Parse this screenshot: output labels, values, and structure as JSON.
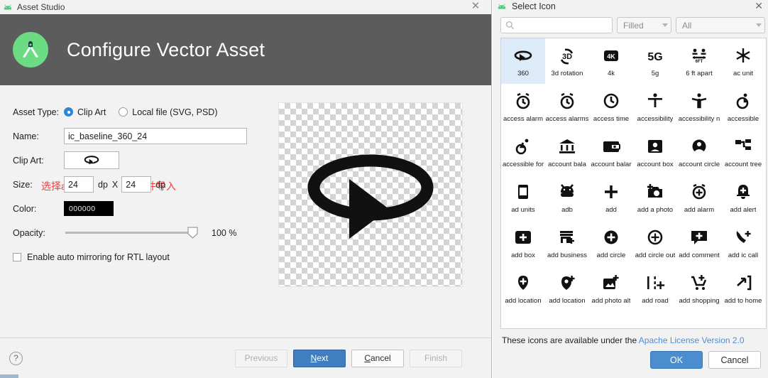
{
  "left_dialog": {
    "titlebar": {
      "title": "Asset Studio",
      "close_icon": "close-icon",
      "logo_icon": "android-logo-icon"
    },
    "header": {
      "title": "Configure Vector Asset",
      "icon": "android-studio-icon"
    },
    "annotations": [
      {
        "text": "选择as自带"
      },
      {
        "text": "从文件导入"
      }
    ],
    "form": {
      "asset_type_label": "Asset Type:",
      "asset_type_options": [
        {
          "label": "Clip Art",
          "selected": true
        },
        {
          "label": "Local file (SVG, PSD)",
          "selected": false
        }
      ],
      "name_label": "Name:",
      "name_value": "ic_baseline_360_24",
      "clip_art_label": "Clip Art:",
      "clip_art_icon": "360-icon",
      "size_label": "Size:",
      "size_width": "24",
      "size_height": "24",
      "size_unit_1": "dp",
      "size_unit_2": "dp",
      "size_separator": "X",
      "color_label": "Color:",
      "color_value": "000000",
      "color_hex": "#000000",
      "opacity_label": "Opacity:",
      "opacity_value": "100 %",
      "opacity_percent": 100,
      "mirroring_label": "Enable auto mirroring for RTL layout",
      "mirroring_checked": false
    },
    "preview": {
      "icon": "360-icon",
      "background": "transparent-checkerboard"
    },
    "footer": {
      "help_label": "?",
      "buttons": [
        {
          "label": "Previous",
          "state": "disabled"
        },
        {
          "label": "Next",
          "state": "primary",
          "mnemonic": "N"
        },
        {
          "label": "Cancel",
          "state": "normal",
          "mnemonic": "C"
        },
        {
          "label": "Finish",
          "state": "disabled"
        }
      ]
    }
  },
  "right_panel": {
    "titlebar": {
      "title": "Select Icon",
      "close_icon": "close-icon",
      "logo_icon": "android-logo-icon"
    },
    "search": {
      "value": "",
      "placeholder": "",
      "icon": "search-icon"
    },
    "style_filter": {
      "value": "Filled"
    },
    "category_filter": {
      "value": "All"
    },
    "icons": [
      {
        "label": "360",
        "glyph": "360-icon",
        "selected": true
      },
      {
        "label": "3d rotation",
        "glyph": "3d-rotation-icon",
        "selected": false
      },
      {
        "label": "4k",
        "glyph": "4k-icon",
        "selected": false
      },
      {
        "label": "5g",
        "glyph": "5g-icon",
        "selected": false
      },
      {
        "label": "6 ft apart",
        "glyph": "six-ft-apart-icon",
        "selected": false
      },
      {
        "label": "ac unit",
        "glyph": "ac-unit-icon",
        "selected": false
      },
      {
        "label": "access alarm",
        "glyph": "access-alarm-icon",
        "selected": false
      },
      {
        "label": "access alarms",
        "glyph": "access-alarms-icon",
        "selected": false
      },
      {
        "label": "access time",
        "glyph": "access-time-icon",
        "selected": false
      },
      {
        "label": "accessibility",
        "glyph": "accessibility-icon",
        "selected": false
      },
      {
        "label": "accessibility n",
        "glyph": "accessibility-new-icon",
        "selected": false
      },
      {
        "label": "accessible",
        "glyph": "accessible-icon",
        "selected": false
      },
      {
        "label": "accessible for",
        "glyph": "accessible-forward-icon",
        "selected": false
      },
      {
        "label": "account bala",
        "glyph": "account-balance-icon",
        "selected": false
      },
      {
        "label": "account balar",
        "glyph": "account-balance-wallet-icon",
        "selected": false
      },
      {
        "label": "account box",
        "glyph": "account-box-icon",
        "selected": false
      },
      {
        "label": "account circle",
        "glyph": "account-circle-icon",
        "selected": false
      },
      {
        "label": "account tree",
        "glyph": "account-tree-icon",
        "selected": false
      },
      {
        "label": "ad units",
        "glyph": "ad-units-icon",
        "selected": false
      },
      {
        "label": "adb",
        "glyph": "adb-icon",
        "selected": false
      },
      {
        "label": "add",
        "glyph": "add-icon",
        "selected": false
      },
      {
        "label": "add a photo",
        "glyph": "add-a-photo-icon",
        "selected": false
      },
      {
        "label": "add alarm",
        "glyph": "add-alarm-icon",
        "selected": false
      },
      {
        "label": "add alert",
        "glyph": "add-alert-icon",
        "selected": false
      },
      {
        "label": "add box",
        "glyph": "add-box-icon",
        "selected": false
      },
      {
        "label": "add business",
        "glyph": "add-business-icon",
        "selected": false
      },
      {
        "label": "add circle",
        "glyph": "add-circle-icon",
        "selected": false
      },
      {
        "label": "add circle out",
        "glyph": "add-circle-outline-icon",
        "selected": false
      },
      {
        "label": "add comment",
        "glyph": "add-comment-icon",
        "selected": false
      },
      {
        "label": "add ic call",
        "glyph": "add-ic-call-icon",
        "selected": false
      },
      {
        "label": "add location",
        "glyph": "add-location-icon",
        "selected": false
      },
      {
        "label": "add location ",
        "glyph": "add-location-alt-icon",
        "selected": false
      },
      {
        "label": "add photo alt",
        "glyph": "add-photo-alternate-icon",
        "selected": false
      },
      {
        "label": "add road",
        "glyph": "add-road-icon",
        "selected": false
      },
      {
        "label": "add shopping",
        "glyph": "add-shopping-cart-icon",
        "selected": false
      },
      {
        "label": "add to home",
        "glyph": "add-to-home-screen-icon",
        "selected": false
      }
    ],
    "license": {
      "text": "These icons are available under the",
      "link_text": "Apache License Version 2.0"
    },
    "buttons": [
      {
        "label": "OK",
        "state": "primary"
      },
      {
        "label": "Cancel",
        "state": "normal"
      }
    ]
  }
}
